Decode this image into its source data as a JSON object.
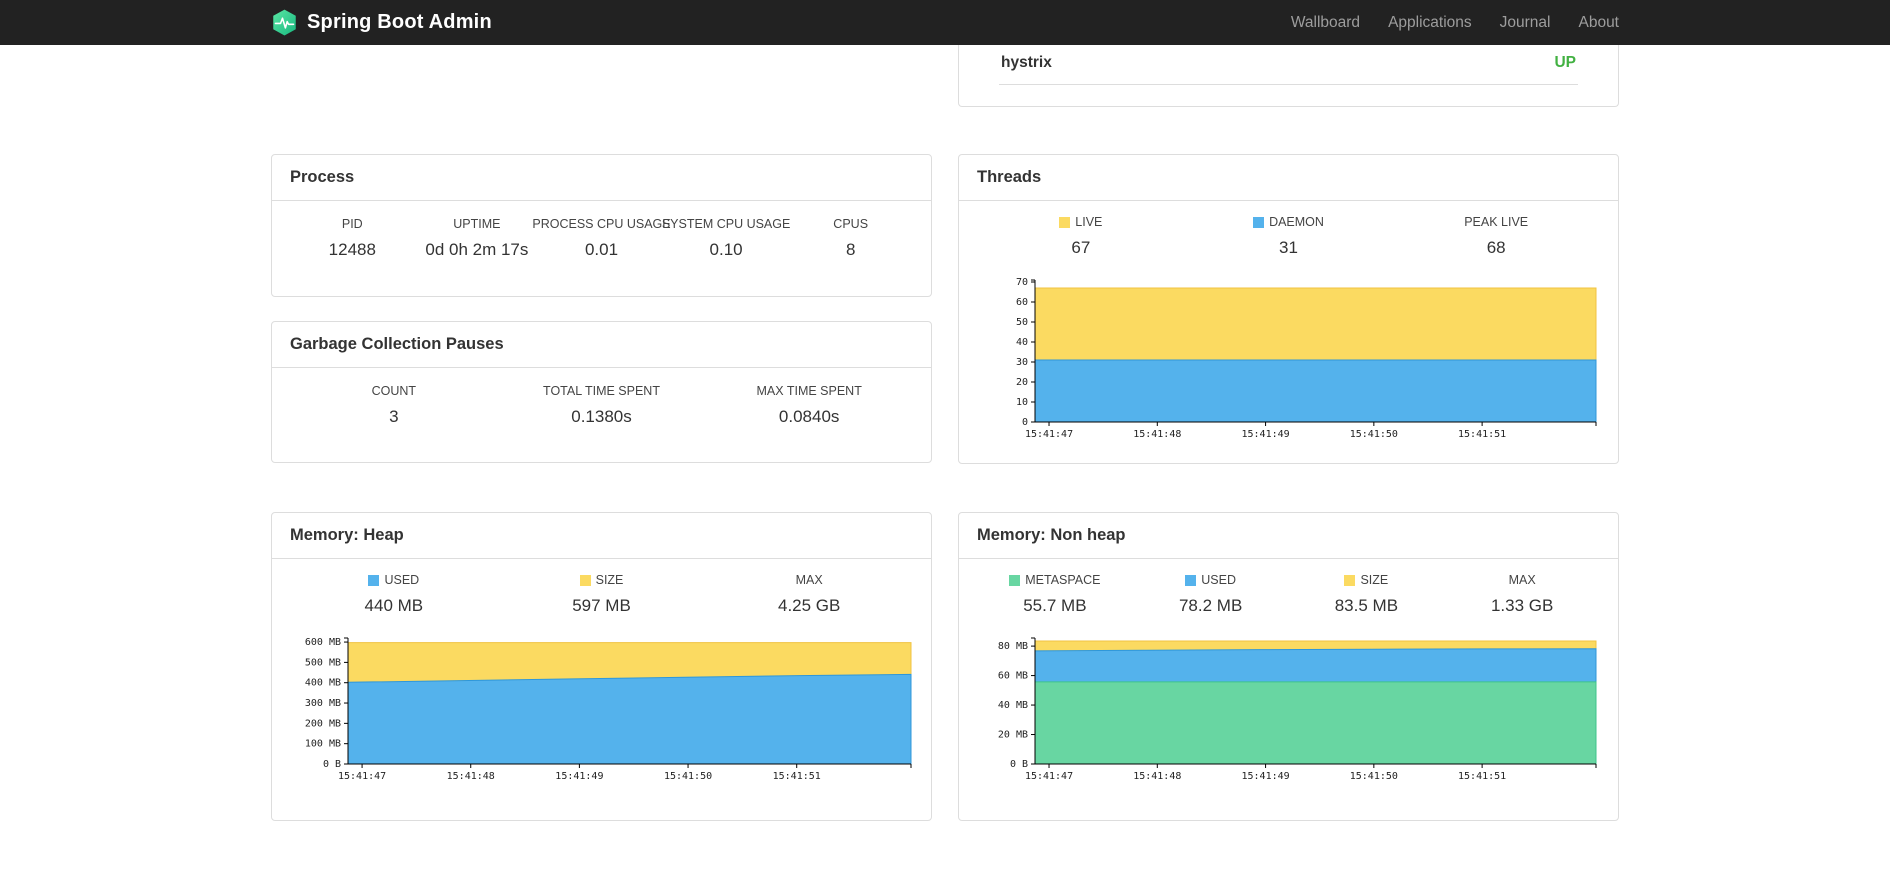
{
  "navbar": {
    "brand": "Spring Boot Admin",
    "items": [
      "Wallboard",
      "Applications",
      "Journal",
      "About"
    ]
  },
  "colors": {
    "up": "#42b142",
    "yellow": "#fbda61",
    "blue": "#54b2ec",
    "green": "#68d6a2"
  },
  "status_card": {
    "application": "hystrix",
    "status": "UP"
  },
  "process": {
    "title": "Process",
    "metrics": [
      {
        "label": "PID",
        "value": "12488"
      },
      {
        "label": "UPTIME",
        "value": "0d 0h 2m 17s"
      },
      {
        "label": "PROCESS CPU USAGE",
        "value": "0.01"
      },
      {
        "label": "SYSTEM CPU USAGE",
        "value": "0.10"
      },
      {
        "label": "CPUS",
        "value": "8"
      }
    ]
  },
  "gc": {
    "title": "Garbage Collection Pauses",
    "metrics": [
      {
        "label": "COUNT",
        "value": "3"
      },
      {
        "label": "TOTAL TIME SPENT",
        "value": "0.1380s"
      },
      {
        "label": "MAX TIME SPENT",
        "value": "0.0840s"
      }
    ]
  },
  "threads": {
    "title": "Threads",
    "metrics": [
      {
        "label": "LIVE",
        "value": "67",
        "color": "#fbda61"
      },
      {
        "label": "DAEMON",
        "value": "31",
        "color": "#54b2ec"
      },
      {
        "label": "PEAK LIVE",
        "value": "68"
      }
    ]
  },
  "memory_heap": {
    "title": "Memory: Heap",
    "metrics": [
      {
        "label": "USED",
        "value": "440 MB",
        "color": "#54b2ec"
      },
      {
        "label": "SIZE",
        "value": "597 MB",
        "color": "#fbda61"
      },
      {
        "label": "MAX",
        "value": "4.25 GB"
      }
    ]
  },
  "memory_nonheap": {
    "title": "Memory: Non heap",
    "metrics": [
      {
        "label": "METASPACE",
        "value": "55.7 MB",
        "color": "#68d6a2"
      },
      {
        "label": "USED",
        "value": "78.2 MB",
        "color": "#54b2ec"
      },
      {
        "label": "SIZE",
        "value": "83.5 MB",
        "color": "#fbda61"
      },
      {
        "label": "MAX",
        "value": "1.33 GB"
      }
    ]
  },
  "chart_data": [
    {
      "id": "threads",
      "type": "area",
      "title": "Threads",
      "x_ticks": [
        "15:41:47",
        "15:41:48",
        "15:41:49",
        "15:41:50",
        "15:41:51"
      ],
      "ylim": [
        0,
        71
      ],
      "y_ticks": [
        {
          "v": 0,
          "label": "0"
        },
        {
          "v": 10,
          "label": "10"
        },
        {
          "v": 20,
          "label": "20"
        },
        {
          "v": 30,
          "label": "30"
        },
        {
          "v": 40,
          "label": "40"
        },
        {
          "v": 50,
          "label": "50"
        },
        {
          "v": 60,
          "label": "60"
        },
        {
          "v": 70,
          "label": "70"
        }
      ],
      "series": [
        {
          "name": "LIVE",
          "fill": "#fbda61",
          "stroke": "#f0c341",
          "values": [
            67,
            67,
            67,
            67,
            67,
            67
          ]
        },
        {
          "name": "DAEMON",
          "fill": "#54b2ec",
          "stroke": "#2f97d9",
          "values": [
            31,
            31,
            31,
            31,
            31,
            31
          ]
        }
      ]
    },
    {
      "id": "memory-heap",
      "type": "area",
      "title": "Memory: Heap",
      "x_ticks": [
        "15:41:47",
        "15:41:48",
        "15:41:49",
        "15:41:50",
        "15:41:51"
      ],
      "ylim": [
        0,
        620
      ],
      "y_ticks": [
        {
          "v": 0,
          "label": "0 B"
        },
        {
          "v": 100,
          "label": "100 MB"
        },
        {
          "v": 200,
          "label": "200 MB"
        },
        {
          "v": 300,
          "label": "300 MB"
        },
        {
          "v": 400,
          "label": "400 MB"
        },
        {
          "v": 500,
          "label": "500 MB"
        },
        {
          "v": 600,
          "label": "600 MB"
        }
      ],
      "series": [
        {
          "name": "SIZE",
          "fill": "#fbda61",
          "stroke": "#f0c341",
          "values": [
            597,
            597,
            597,
            597,
            597,
            597
          ]
        },
        {
          "name": "USED",
          "fill": "#54b2ec",
          "stroke": "#2f97d9",
          "values": [
            402,
            410,
            419,
            427,
            435,
            441
          ]
        }
      ]
    },
    {
      "id": "memory-nonheap",
      "type": "area",
      "title": "Memory: Non heap",
      "x_ticks": [
        "15:41:47",
        "15:41:48",
        "15:41:49",
        "15:41:50",
        "15:41:51"
      ],
      "ylim": [
        0,
        85.5
      ],
      "y_ticks": [
        {
          "v": 0,
          "label": "0 B"
        },
        {
          "v": 20,
          "label": "20 MB"
        },
        {
          "v": 40,
          "label": "40 MB"
        },
        {
          "v": 60,
          "label": "60 MB"
        },
        {
          "v": 80,
          "label": "80 MB"
        }
      ],
      "series": [
        {
          "name": "SIZE",
          "fill": "#fbda61",
          "stroke": "#f0c341",
          "values": [
            83.5,
            83.5,
            83.5,
            83.5,
            83.5,
            83.5
          ]
        },
        {
          "name": "USED",
          "fill": "#54b2ec",
          "stroke": "#2f97d9",
          "values": [
            76.8,
            77.2,
            77.6,
            77.9,
            78.1,
            78.2
          ]
        },
        {
          "name": "METASPACE",
          "fill": "#68d6a2",
          "stroke": "#3ec48b",
          "values": [
            55.7,
            55.7,
            55.7,
            55.7,
            55.7,
            55.7
          ]
        }
      ]
    }
  ]
}
